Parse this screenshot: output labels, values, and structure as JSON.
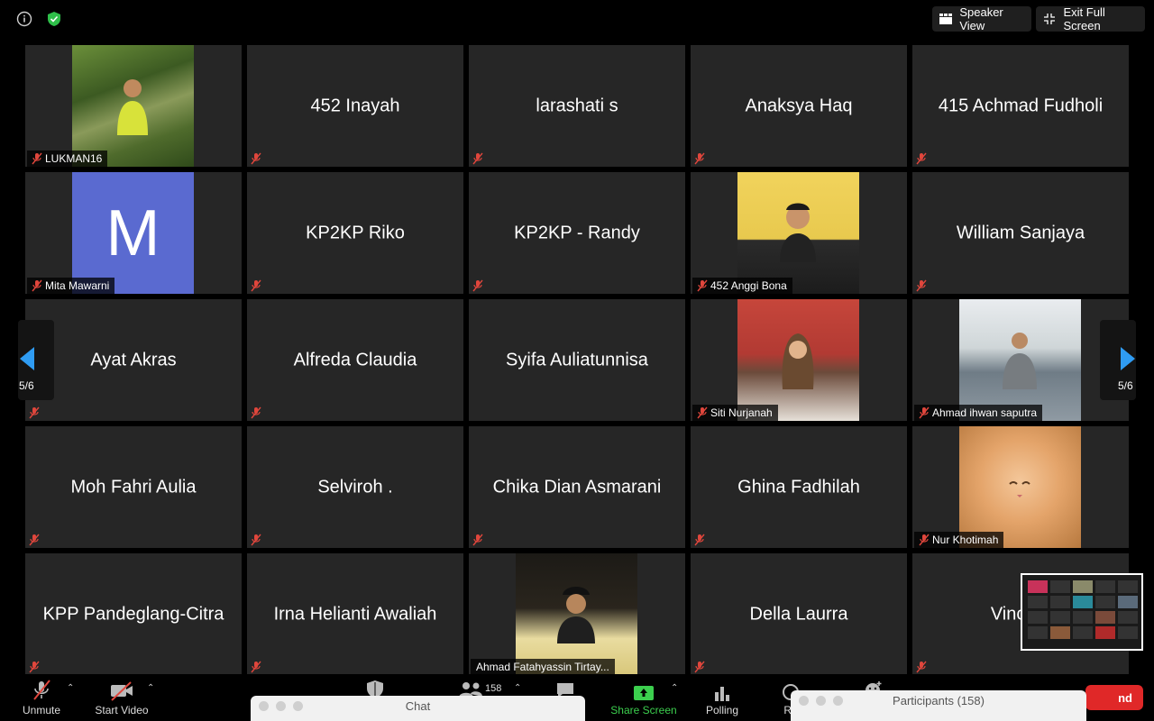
{
  "top_bar": {
    "speaker_view_label": "Speaker View",
    "exit_full_screen_label": "Exit Full Screen"
  },
  "gallery": {
    "page_indicator_left": "5/6",
    "page_indicator_right": "5/6",
    "tiles": [
      {
        "name": "LUKMAN16"
      },
      {
        "name": "452 Inayah"
      },
      {
        "name": "larashati s"
      },
      {
        "name": "Anaksya Haq"
      },
      {
        "name": "415 Achmad Fudholi"
      },
      {
        "name": "Mita Mawarni",
        "avatar_letter": "M"
      },
      {
        "name": "KP2KP Riko"
      },
      {
        "name": "KP2KP - Randy"
      },
      {
        "name": "452 Anggi Bona"
      },
      {
        "name": "William Sanjaya"
      },
      {
        "name": "Ayat Akras"
      },
      {
        "name": "Alfreda Claudia"
      },
      {
        "name": "Syifa Auliatunnisa"
      },
      {
        "name": "Siti Nurjanah"
      },
      {
        "name": "Ahmad ihwan saputra"
      },
      {
        "name": "Moh Fahri Aulia"
      },
      {
        "name": "Selviroh ."
      },
      {
        "name": "Chika Dian Asmarani"
      },
      {
        "name": "Ghina Fadhilah"
      },
      {
        "name": "Nur Khotimah"
      },
      {
        "name": "KPP Pandeglang-Citra"
      },
      {
        "name": "Irna Helianti Awaliah"
      },
      {
        "name": "Ahmad Fatahyassin Tirtay..."
      },
      {
        "name": "Della Laurra"
      },
      {
        "name": "Vincent"
      }
    ]
  },
  "toolbar": {
    "unmute_label": "Unmute",
    "start_video_label": "Start Video",
    "participants_count": "158",
    "share_screen_label": "Share Screen",
    "polling_label": "Polling",
    "record_label_partial": "Re",
    "end_label_partial": "nd"
  },
  "chat_panel": {
    "title": "Chat"
  },
  "participants_panel": {
    "title": "Participants (158)"
  },
  "colors": {
    "tile_bg": "#262626",
    "accent_blue": "#2f9cf3",
    "share_green": "#3ccf4e",
    "end_red": "#e02828",
    "avatar_purple": "#5a6ad0"
  }
}
